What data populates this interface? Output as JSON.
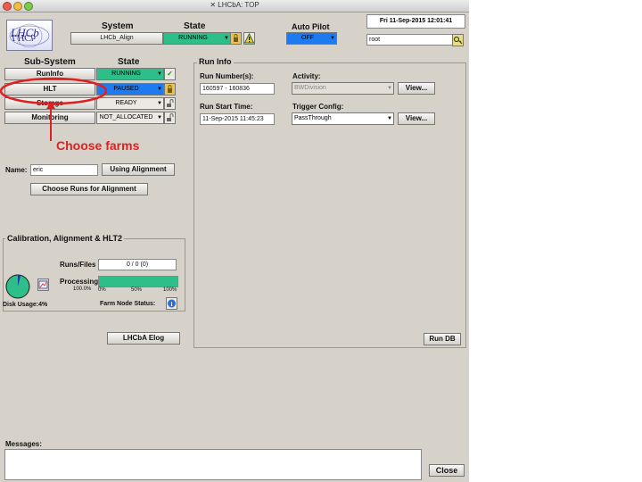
{
  "window": {
    "title": "LHCbA: TOP"
  },
  "colors": {
    "running": "#2ebe8a",
    "paused": "#1e7af0",
    "annotation": "#e02020",
    "panel": "#d6d2ca"
  },
  "header": {
    "system_label": "System",
    "state_label": "State",
    "system_value": "LHCb_Align",
    "state_value": "RUNNING",
    "autopilot_label": "Auto Pilot",
    "autopilot_value": "OFF",
    "datetime": "Fri  11-Sep-2015    12:01:41",
    "user": "root"
  },
  "subsystems": {
    "col_subsystem": "Sub-System",
    "col_state": "State",
    "rows": [
      {
        "name": "RunInfo",
        "state": "RUNNING"
      },
      {
        "name": "HLT",
        "state": "PAUSED"
      },
      {
        "name": "Storage",
        "state": "READY"
      },
      {
        "name": "Monitoring",
        "state": "NOT_ALLOCATED"
      }
    ]
  },
  "annotation": {
    "text": "Choose farms"
  },
  "alignment": {
    "name_label": "Name:",
    "name_value": "eric",
    "using_alignment": "Using Alignment",
    "choose_runs": "Choose Runs for Alignment"
  },
  "calib": {
    "title": "Calibration, Alignment & HLT2",
    "runs_files_label": "Runs/Files",
    "runs_files_value": "0 / 0 (0)",
    "processing_label": "Processing",
    "processing_pct": "100.0%",
    "progress": 1.0,
    "tick_0": "0%",
    "tick_50": "50%",
    "tick_100": "100%",
    "disk_usage": "Disk Usage:4%",
    "disk_fraction": 0.04,
    "farm_node_status": "Farm Node Status:"
  },
  "elog_button": "LHCbA Elog",
  "runinfo": {
    "title": "Run Info",
    "run_numbers_label": "Run Number(s):",
    "run_numbers_value": "160597 - 160836",
    "activity_label": "Activity:",
    "activity_value": "BWDivision",
    "view_label": "View...",
    "start_time_label": "Run Start Time:",
    "start_time_value": "11-Sep-2015 11:45:23",
    "trigger_label": "Trigger Config:",
    "trigger_value": "PassThrough",
    "rundb_button": "Run DB"
  },
  "messages": {
    "label": "Messages:",
    "close_button": "Close"
  }
}
